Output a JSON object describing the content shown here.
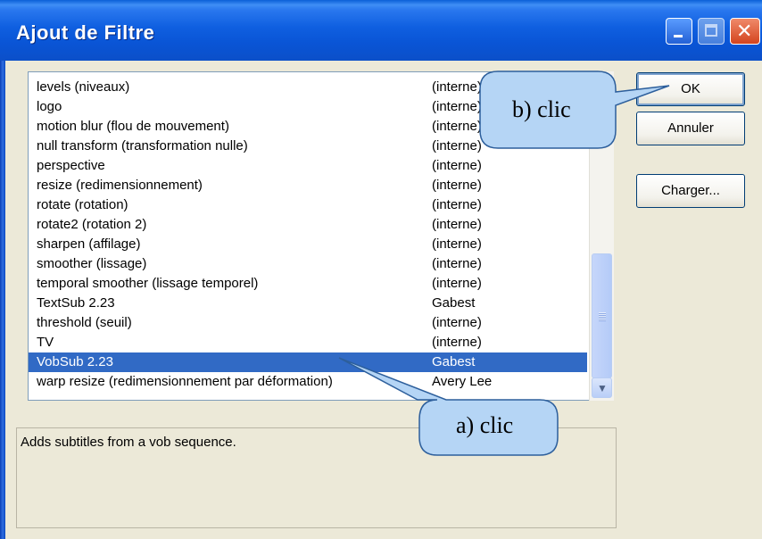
{
  "window": {
    "title": "Ajout de Filtre"
  },
  "filters": [
    {
      "name": "levels (niveaux)",
      "author": "(interne)"
    },
    {
      "name": "logo",
      "author": "(interne)"
    },
    {
      "name": "motion blur (flou de mouvement)",
      "author": "(interne)"
    },
    {
      "name": "null transform (transformation nulle)",
      "author": "(interne)"
    },
    {
      "name": "perspective",
      "author": "(interne)"
    },
    {
      "name": "resize (redimensionnement)",
      "author": "(interne)"
    },
    {
      "name": "rotate (rotation)",
      "author": "(interne)"
    },
    {
      "name": "rotate2 (rotation 2)",
      "author": "(interne)"
    },
    {
      "name": "sharpen (affilage)",
      "author": "(interne)"
    },
    {
      "name": "smoother (lissage)",
      "author": "(interne)"
    },
    {
      "name": "temporal smoother (lissage temporel)",
      "author": "(interne)"
    },
    {
      "name": "TextSub 2.23",
      "author": "Gabest"
    },
    {
      "name": "threshold (seuil)",
      "author": "(interne)"
    },
    {
      "name": "TV",
      "author": "(interne)"
    },
    {
      "name": "VobSub 2.23",
      "author": "Gabest",
      "selected": true
    },
    {
      "name": "warp resize (redimensionnement par déformation)",
      "author": "Avery Lee"
    }
  ],
  "description": "Adds subtitles from a vob sequence.",
  "buttons": {
    "ok": "OK",
    "cancel": "Annuler",
    "load": "Charger..."
  },
  "callouts": {
    "a": "a) clic",
    "b": "b) clic"
  },
  "colors": {
    "selection": "#316ac5",
    "callout_fill": "#b5d5f5"
  }
}
